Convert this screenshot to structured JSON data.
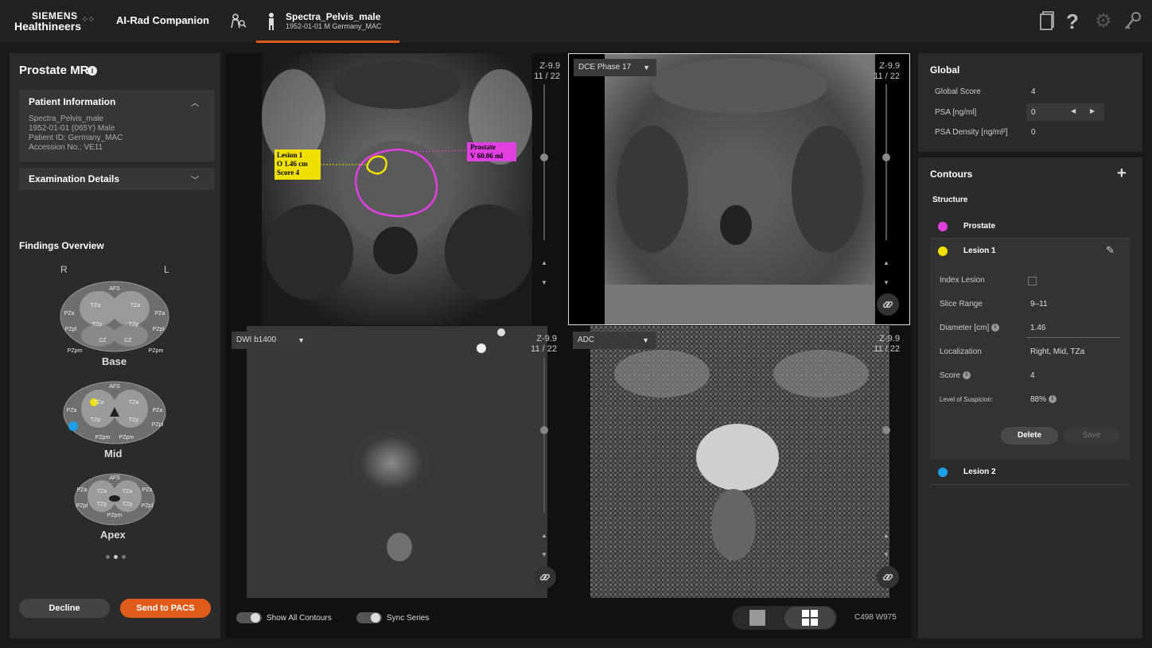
{
  "header": {
    "brand_line1": "SIEMENS",
    "brand_line2": "Healthineers",
    "app_name": "AI-Rad Companion",
    "patient_name": "Spectra_Pelvis_male",
    "patient_sub": "1952-01-01 M Germany_MAC",
    "icons": [
      "patient-search-icon",
      "person-icon",
      "document-icon",
      "help-icon",
      "gear-icon",
      "key-icon"
    ]
  },
  "left": {
    "title": "Prostate MR",
    "patient_info": {
      "title": "Patient Information",
      "lines": [
        "Spectra_Pelvis_male",
        "1952-01-01 (065Y) Male",
        "Patient ID: Germany_MAC",
        "Accession No.: VE11"
      ]
    },
    "exam_details": {
      "title": "Examination Details"
    },
    "findings": {
      "title": "Findings Overview",
      "r": "R",
      "l": "L",
      "sections": [
        "Base",
        "Mid",
        "Apex"
      ],
      "zones_base": [
        "AFS",
        "TZa",
        "TZa",
        "PZa",
        "PZa",
        "TZp",
        "TZp",
        "PZpl",
        "PZpl",
        "CZ",
        "CZ",
        "PZpm",
        "PZpm"
      ],
      "zones_mid": [
        "AFS",
        "TZa",
        "TZa",
        "PZa",
        "PZa",
        "TZp",
        "TZp",
        "PZpl",
        "PZpm",
        "PZpm"
      ],
      "zones_apex": [
        "AFS",
        "PZa",
        "PZa",
        "TZa",
        "TZa",
        "PZpl",
        "PZpl",
        "TZp",
        "TZp",
        "PZpm"
      ]
    },
    "decline_label": "Decline",
    "pacs_label": "Send to PACS"
  },
  "viewer": {
    "vp1": {
      "z": "Z-9.9",
      "slice": "11 / 22",
      "lesion_label": [
        "Lesion 1",
        "O 1.46 cm",
        "Score 4"
      ],
      "prostate_label": [
        "Prostate",
        "V 60.06 ml"
      ]
    },
    "vp2": {
      "series": "DCE Phase 17",
      "z": "Z-9.9",
      "slice": "11 / 22"
    },
    "vp3": {
      "series": "DWI b1400",
      "z": "Z-9.9",
      "slice": "11 / 22"
    },
    "vp4": {
      "series": "ADC",
      "z": "Z-9.9",
      "slice": "11 / 22"
    },
    "show_contours": "Show All Contours",
    "sync_series": "Sync Series",
    "cw": "C498  W975"
  },
  "global": {
    "title": "Global",
    "rows": [
      {
        "label": "Global Score",
        "value": "4"
      },
      {
        "label": "PSA [ng/ml]",
        "value": "0"
      },
      {
        "label": "PSA Density [ng/ml²]",
        "value": "0"
      }
    ]
  },
  "contours": {
    "title": "Contours",
    "structure_label": "Structure",
    "structures": [
      {
        "name": "Prostate",
        "color": "#e040e0"
      },
      {
        "name": "Lesion 1",
        "color": "#f0e000"
      },
      {
        "name": "Lesion 2",
        "color": "#1ea0e6"
      }
    ],
    "lesion_detail": [
      {
        "label": "Index Lesion",
        "value": ""
      },
      {
        "label": "Slice Range",
        "value": "9–11"
      },
      {
        "label": "Diameter [cm]",
        "value": "1.46"
      },
      {
        "label": "Localization",
        "value": "Right, Mid, TZa"
      },
      {
        "label": "Score",
        "value": "4"
      },
      {
        "label": "Level of Suspicion:",
        "value": "88%"
      }
    ],
    "delete_label": "Delete",
    "save_label": "Save"
  },
  "colors": {
    "accent": "#e05a1a",
    "prostate": "#e040e0",
    "lesion1": "#f0e000",
    "lesion2": "#1ea0e6"
  }
}
